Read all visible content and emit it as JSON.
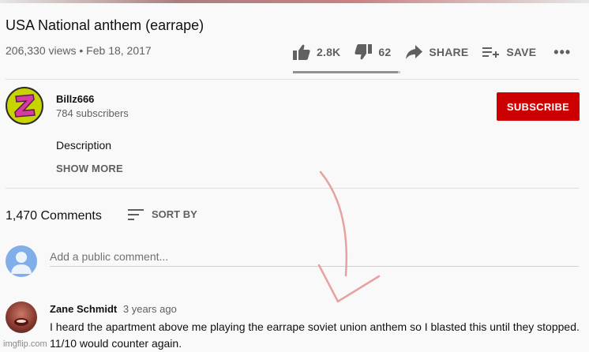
{
  "video": {
    "title": "USA National anthem (earrape)",
    "meta": "206,330 views • Feb 18, 2017"
  },
  "actions": {
    "like_count": "2.8K",
    "dislike_count": "62",
    "share_label": "SHARE",
    "save_label": "SAVE",
    "more_label": "•••",
    "like_ratio": 0.978
  },
  "channel": {
    "name": "Billz666",
    "subscribers": "784 subscribers",
    "subscribe_label": "SUBSCRIBE"
  },
  "description": {
    "text": "Description",
    "show_more_label": "SHOW MORE"
  },
  "comments": {
    "count_label": "1,470 Comments",
    "sort_label": "SORT BY",
    "input_placeholder": "Add a public comment...",
    "items": [
      {
        "author": "Zane Schmidt",
        "time": "3 years ago",
        "text": "I heard the apartment above me playing the earrape soviet union anthem so I blasted this until they stopped. 11/10 would counter again."
      }
    ]
  },
  "watermark": "imgflip.com",
  "colors": {
    "subscribe_bg": "#cc0000",
    "annotation_arrow": "#e8a0a0",
    "secondary_text": "#606060"
  },
  "icons": {
    "like": "thumbs-up-icon",
    "dislike": "thumbs-down-icon",
    "share": "share-arrow-icon",
    "save": "playlist-add-icon",
    "sort": "sort-lines-icon"
  }
}
